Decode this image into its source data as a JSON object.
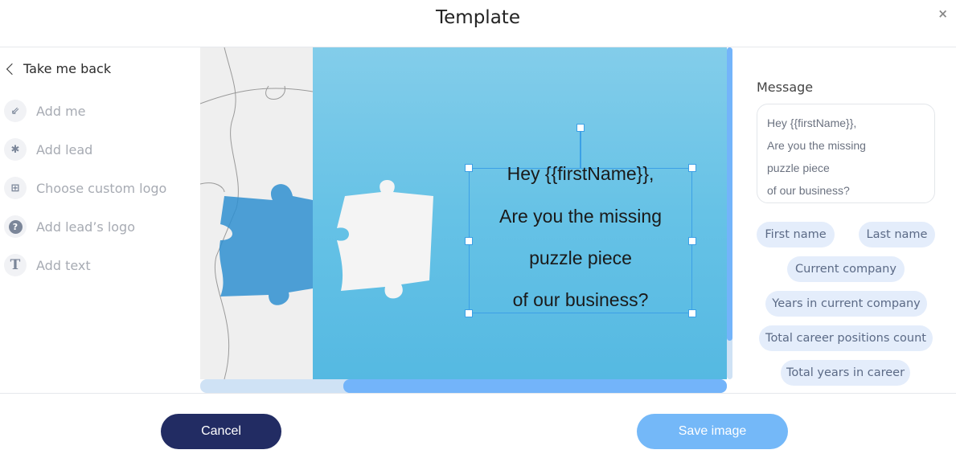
{
  "header": {
    "title": "Template",
    "close_label": "×"
  },
  "sidebar": {
    "back_label": "Take me back",
    "items": [
      {
        "label": "Add me",
        "icon": "person-arrow-icon"
      },
      {
        "label": "Add lead",
        "icon": "person-star-icon"
      },
      {
        "label": "Choose custom logo",
        "icon": "logo-grid-icon"
      },
      {
        "label": "Add lead’s logo",
        "icon": "question-icon"
      },
      {
        "label": "Add text",
        "icon": "text-icon"
      }
    ]
  },
  "canvas": {
    "text_lines": [
      "Hey {{firstName}},",
      "Are you the missing",
      "puzzle piece",
      "of our business?"
    ],
    "colors": {
      "selection": "#3ca0e6",
      "scroll_thumb": "#73b4fa"
    }
  },
  "message": {
    "label": "Message",
    "lines": [
      "Hey {{firstName}},",
      "Are you the missing",
      "puzzle piece",
      "of our business?"
    ]
  },
  "variables": [
    "First name",
    "Last name",
    "Current company",
    "Years in current company",
    "Total career positions count",
    "Total years in career"
  ],
  "footer": {
    "cancel_label": "Cancel",
    "save_label": "Save image"
  },
  "colors": {
    "cancel": "#222c63",
    "save": "#74b8f8",
    "chip_bg": "#e4edfb"
  }
}
